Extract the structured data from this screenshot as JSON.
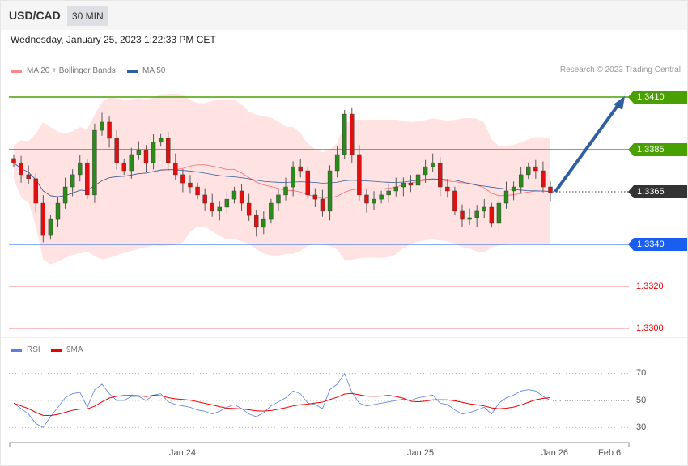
{
  "header": {
    "symbol": "USD/CAD",
    "timeframe": "30 MIN"
  },
  "datetime": "Wednesday, January 25, 2023 1:22:33 PM CET",
  "legend": {
    "ma20": "MA 20 + Bollinger Bands",
    "ma50": "MA 50",
    "rsi": "RSI",
    "ma9": "9MA"
  },
  "copyright": "Research © 2023 Trading Central",
  "levels": [
    {
      "label": "1.3410",
      "price": 1.341,
      "type": "resistance",
      "color": "#4aa000"
    },
    {
      "label": "1.3385",
      "price": 1.3385,
      "type": "resistance",
      "color": "#4aa000"
    },
    {
      "label": "1.3365",
      "price": 1.3365,
      "type": "current",
      "color": "#333333"
    },
    {
      "label": "1.3340",
      "price": 1.334,
      "type": "pivot",
      "color": "#1a5ef0"
    },
    {
      "label": "1.3320",
      "price": 1.332,
      "type": "support",
      "color": "#e02020"
    },
    {
      "label": "1.3300",
      "price": 1.33,
      "type": "support",
      "color": "#e02020"
    }
  ],
  "rsi_axis": [
    "70",
    "50",
    "30"
  ],
  "x_axis": [
    "Jan 24",
    "Jan 25",
    "Jan 26",
    "Feb 6"
  ],
  "chart_data": {
    "type": "candlestick",
    "closes": [
      1.33788,
      1.33731,
      1.33712,
      1.33596,
      1.33442,
      1.33519,
      1.33596,
      1.33673,
      1.33731,
      1.33788,
      1.33635,
      1.33942,
      1.33981,
      1.33904,
      1.33788,
      1.3375,
      1.33827,
      1.33846,
      1.33788,
      1.33885,
      1.33904,
      1.33788,
      1.33731,
      1.33692,
      1.33673,
      1.33635,
      1.33596,
      1.33558,
      1.33577,
      1.33615,
      1.33654,
      1.33596,
      1.33538,
      1.33481,
      1.33519,
      1.33596,
      1.33635,
      1.33673,
      1.33769,
      1.3375,
      1.33635,
      1.33615,
      1.33558,
      1.3375,
      1.33827,
      1.34019,
      1.33827,
      1.33635,
      1.33596,
      1.33615,
      1.33635,
      1.33654,
      1.33673,
      1.33692,
      1.33681,
      1.33731,
      1.33769,
      1.33788,
      1.33673,
      1.33654,
      1.33558,
      1.33519,
      1.33527,
      1.33558,
      1.33577,
      1.335,
      1.33596,
      1.33654,
      1.33673,
      1.33731,
      1.33769,
      1.3375,
      1.33673,
      1.33646
    ],
    "rsi": [
      48,
      44,
      40,
      33,
      30,
      38,
      45,
      52,
      55,
      56,
      45,
      58,
      62,
      55,
      50,
      50,
      53,
      53,
      50,
      54,
      55,
      49,
      47,
      46,
      45,
      43,
      42,
      40,
      42,
      45,
      47,
      44,
      40,
      38,
      41,
      46,
      49,
      52,
      57,
      55,
      48,
      47,
      44,
      58,
      62,
      70,
      56,
      48,
      46,
      47,
      48,
      49,
      50,
      51,
      50,
      52,
      53,
      54,
      48,
      47,
      43,
      40,
      41,
      43,
      45,
      40,
      48,
      52,
      54,
      57,
      58,
      57,
      53,
      50
    ],
    "price_range": [
      1.3296,
      1.3425
    ],
    "rsi_range": [
      30,
      70
    ]
  },
  "forecast": {
    "target": 1.341
  }
}
